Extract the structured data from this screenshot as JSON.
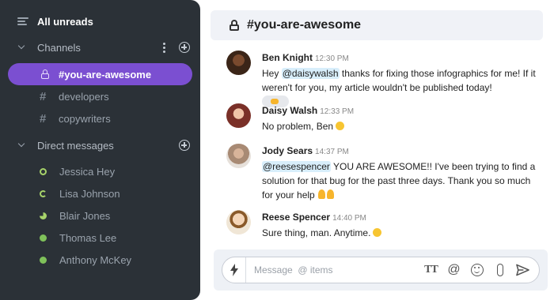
{
  "sidebar": {
    "all_unreads": "All unreads",
    "channels_label": "Channels",
    "channels": [
      {
        "name": "#you-are-awesome",
        "active": true,
        "private": true
      },
      {
        "name": "developers",
        "active": false
      },
      {
        "name": "copywriters",
        "active": false
      }
    ],
    "dm_label": "Direct messages",
    "direct_messages": [
      {
        "name": "Jessica Hey",
        "status": "ring"
      },
      {
        "name": "Lisa Johnson",
        "status": "refresh"
      },
      {
        "name": "Blair Jones",
        "status": "pie"
      },
      {
        "name": "Thomas Lee",
        "status": "dot"
      },
      {
        "name": "Anthony McKey",
        "status": "dot"
      }
    ]
  },
  "header": {
    "title": "#you-are-awesome"
  },
  "messages": [
    {
      "author": "Ben Knight",
      "time": "12:30 PM",
      "pre": "Hey ",
      "mention": "@daisywalsh",
      "post": " thanks for fixing those infographics for me! If it weren't for you, my article wouldn't be published today!"
    },
    {
      "author": "Daisy Walsh",
      "time": "12:33 PM",
      "text": "No problem, Ben"
    },
    {
      "author": "Jody Sears",
      "time": "14:37 PM",
      "mention": "@reesespencer",
      "post": " YOU ARE AWESOME!! I've been trying to find a solution for that bug for the past three days. Thank you so much for your help"
    },
    {
      "author": "Reese Spencer",
      "time": "14:40 PM",
      "text": "Sure thing, man. Anytime."
    }
  ],
  "composer": {
    "placeholder": "Message  @ items"
  },
  "colors": {
    "sidebar_bg": "#2b3137",
    "active_channel": "#7b4fd1",
    "online": "#7fc15a",
    "mention_bg": "#d8eefb"
  }
}
